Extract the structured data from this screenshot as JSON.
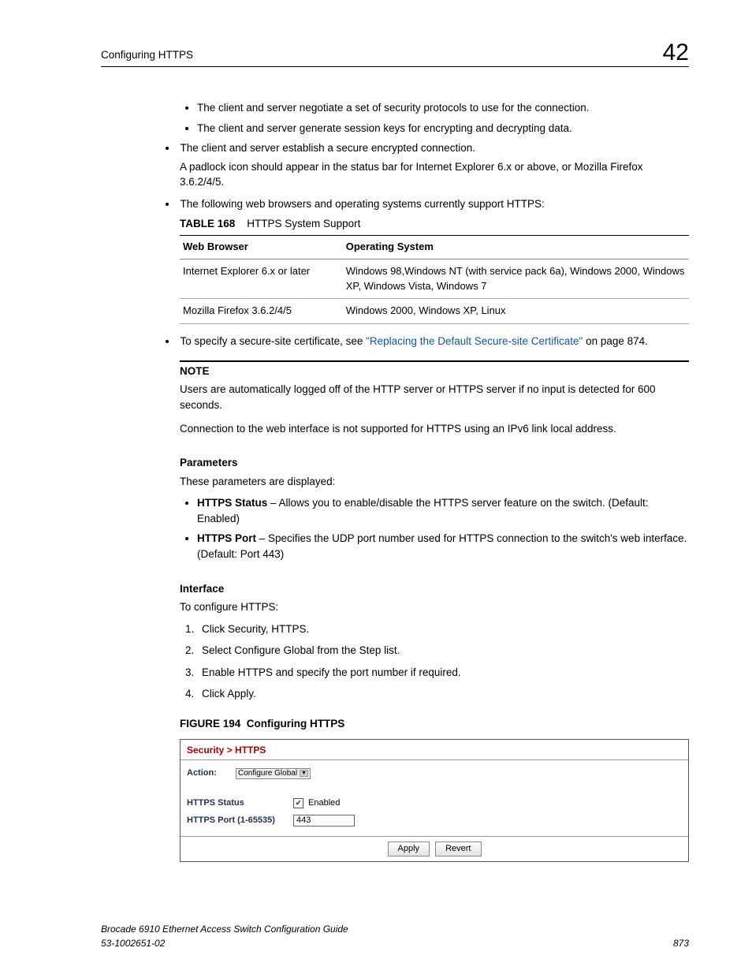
{
  "header": {
    "title": "Configuring HTTPS",
    "chapter": "42"
  },
  "bullets_inner": [
    "The client and server negotiate a set of security protocols to use for the connection.",
    "The client and server generate session keys for encrypting and decrypting data."
  ],
  "bullet_secure": "The client and server establish a secure encrypted connection.",
  "padlock_text": "A padlock icon should appear in the status bar for Internet Explorer 6.x or above, or Mozilla Firefox 3.6.2/4/5.",
  "bullet_browsers": "The following web browsers and operating systems currently support HTTPS:",
  "table_caption": {
    "label": "TABLE 168",
    "title": "HTTPS System Support"
  },
  "table": {
    "headers": [
      "Web Browser",
      "Operating System"
    ],
    "rows": [
      [
        "Internet Explorer 6.x or later",
        "Windows 98,Windows NT (with service pack 6a), Windows 2000, Windows XP, Windows Vista, Windows 7"
      ],
      [
        "Mozilla Firefox 3.6.2/4/5",
        "Windows 2000, Windows XP, Linux"
      ]
    ]
  },
  "cert_bullet": {
    "pre": "To specify a secure-site certificate, see ",
    "link": "\"Replacing the Default Secure-site Certificate\"",
    "post": " on page 874."
  },
  "note": {
    "label": "NOTE",
    "p1": "Users are automatically logged off of the HTTP server or HTTPS server if no input is detected for 600 seconds.",
    "p2": "Connection to the web interface is not supported for HTTPS using an IPv6 link local address."
  },
  "parameters": {
    "heading": "Parameters",
    "intro": "These parameters are displayed:",
    "items": [
      {
        "label": "HTTPS Status",
        "text": " – Allows you to enable/disable the HTTPS server feature on the switch. (Default: Enabled)"
      },
      {
        "label": "HTTPS Port",
        "text": " – Specifies the UDP port number used for HTTPS connection to the switch's web interface. (Default: Port 443)"
      }
    ]
  },
  "interface": {
    "heading": "Interface",
    "intro": "To configure HTTPS:",
    "steps": [
      "Click Security, HTTPS.",
      "Select Configure Global from the Step list.",
      "Enable HTTPS and specify the port number if required.",
      "Click Apply."
    ]
  },
  "figure": {
    "label": "FIGURE 194",
    "title": "Configuring HTTPS"
  },
  "screenshot": {
    "breadcrumb": "Security > HTTPS",
    "action_label": "Action:",
    "action_value": "Configure Global",
    "status_label": "HTTPS Status",
    "status_text": "Enabled",
    "status_checked": true,
    "port_label": "HTTPS Port (1-65535)",
    "port_value": "443",
    "apply": "Apply",
    "revert": "Revert"
  },
  "footer": {
    "book": "Brocade 6910 Ethernet Access Switch Configuration Guide",
    "docnum": "53-1002651-02",
    "page": "873"
  }
}
